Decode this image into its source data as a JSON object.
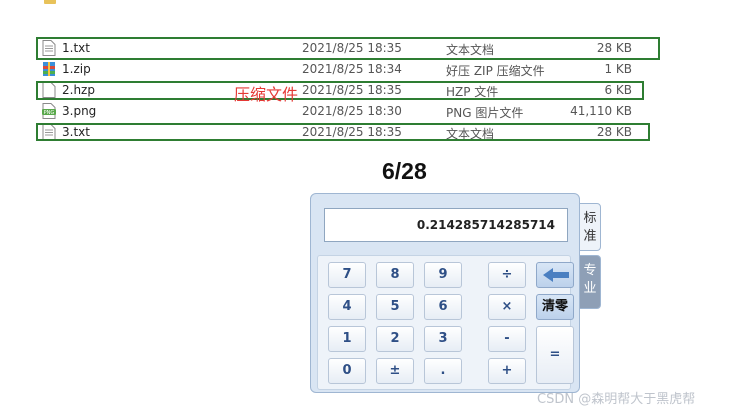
{
  "files": [
    {
      "name": "1.txt",
      "date": "2021/8/25 18:35",
      "type": "文本文档",
      "size": "28 KB",
      "icon": "text-file-icon"
    },
    {
      "name": "1.zip",
      "date": "2021/8/25 18:34",
      "type": "好压 ZIP 压缩文件",
      "size": "1 KB",
      "icon": "zip-archive-icon"
    },
    {
      "name": "2.hzp",
      "date": "2021/8/25 18:35",
      "type": "HZP 文件",
      "size": "6 KB",
      "icon": "blank-file-icon"
    },
    {
      "name": "3.png",
      "date": "2021/8/25 18:30",
      "type": "PNG 图片文件",
      "size": "41,110 KB",
      "icon": "png-image-icon"
    },
    {
      "name": "3.txt",
      "date": "2021/8/25 18:35",
      "type": "文本文档",
      "size": "28 KB",
      "icon": "text-file-icon"
    }
  ],
  "annotation": "压缩文件",
  "ratio_label": "6/28",
  "calculator": {
    "display": "0.214285714285714",
    "keys": {
      "k7": "7",
      "k8": "8",
      "k9": "9",
      "div": "÷",
      "k4": "4",
      "k5": "5",
      "k6": "6",
      "mul": "×",
      "clear": "清零",
      "k1": "1",
      "k2": "2",
      "k3": "3",
      "sub": "-",
      "eq": "=",
      "k0": "0",
      "sign": "±",
      "dot": ".",
      "add": "+"
    },
    "tabs": {
      "standard": "标准",
      "pro": "专业"
    }
  },
  "watermark": "CSDN @森明帮大于黑虎帮",
  "colors": {
    "highlight_box": "#2e7d32",
    "annotation": "#e53935"
  }
}
